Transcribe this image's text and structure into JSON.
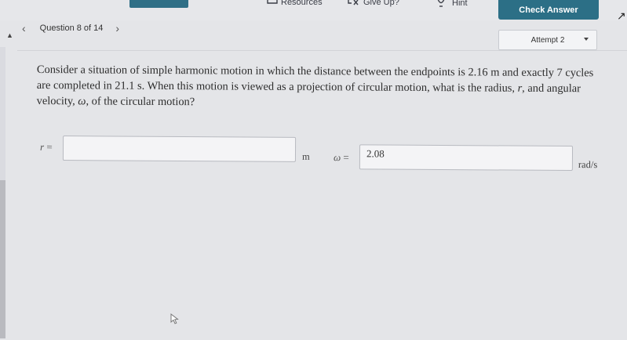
{
  "toolbar": {
    "resources_label": "Resources",
    "give_up_label": "Give Up?",
    "hint_label": "Hint",
    "check_answer_label": "Check Answer",
    "accent_color": "#2c6f86"
  },
  "question_nav": {
    "label": "Question 8 of 14",
    "prev_icon": "chevron-left-icon",
    "next_icon": "chevron-right-icon"
  },
  "attempt": {
    "label": "Attempt 2"
  },
  "question": {
    "part1": "Consider a situation of simple harmonic motion in which the distance between the endpoints is 2.16 m and exactly 7 cycles are completed in 21.1 s. When this motion is viewed as a projection of circular motion, what is the radius, ",
    "r_symbol": "r",
    "part2": ", and angular velocity, ",
    "omega_symbol": "ω",
    "part3": ", of the circular motion?"
  },
  "answers": {
    "r": {
      "symbol": "r",
      "equals": " =",
      "value": "",
      "placeholder": "",
      "unit": "m"
    },
    "omega": {
      "symbol": "ω",
      "equals": " =",
      "value": "2.08",
      "unit": "rad/s"
    }
  }
}
